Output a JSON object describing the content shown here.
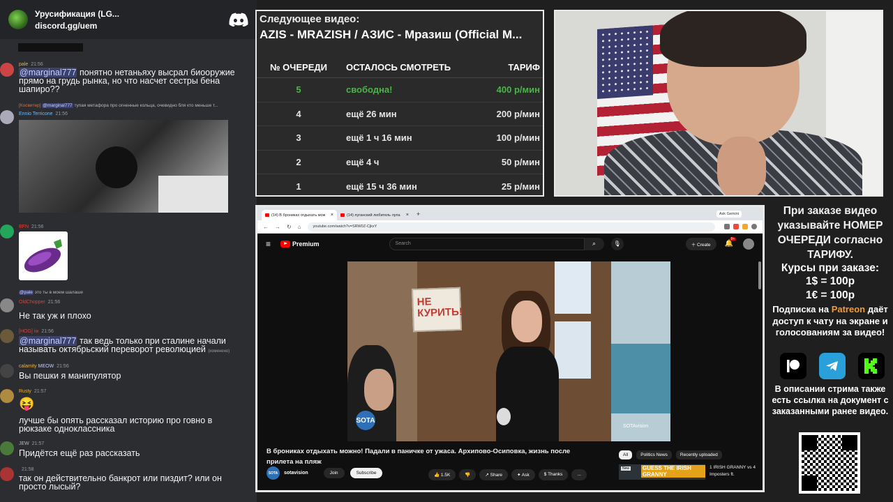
{
  "discord": {
    "server_name": "Урусификация (LG...",
    "server_link": "discord.gg/uem",
    "messages": [
      {
        "user": "pale",
        "time": "21:56",
        "user_color": "#f0b232",
        "mention": "@marginal777",
        "text": " понятно нетаньяху высрал биооружие прямо на грудь рынка, но что насчет сестры бена шапиро??"
      },
      {
        "reply": "тупая метафора про огненные кольца, очевидно бля кто меньше т...",
        "reply_user": "[Косвитер]",
        "reply_mention": "@marginal777",
        "user": "Ennio Terricone",
        "time": "21:56",
        "user_color": "#79b8f1"
      },
      {
        "user": "ВFN",
        "time": "21:56",
        "user_color": "#e0403a"
      },
      {
        "reply": "это ты в моем шалаше",
        "reply_mention": "@pale",
        "user": "OldChopper",
        "time": "21:56",
        "user_color": "#e0403a",
        "text": "Не так уж и плохо"
      },
      {
        "user": "[HOG] iw",
        "time": "21:56",
        "user_color": "#e0403a",
        "mention": "@marginal777",
        "text": " так ведь только при сталине начали называть октябрьский переворот революцией",
        "edited": "(изменено)"
      },
      {
        "user": "calamity",
        "badge": "MEOW",
        "time": "21:56",
        "user_color": "#f0b232",
        "text": "Вы пешки я манипулятор"
      },
      {
        "user": "Rusty",
        "time": "21:57",
        "user_color": "#f0b232",
        "text": "лучше бы опять рассказал историю про говно в рюкзаке одноклассника"
      },
      {
        "user": "JEW",
        "time": "21:57",
        "user_color": "#b5bac1",
        "text": "Придётся ещё раз рассказать"
      },
      {
        "user": "",
        "time": "21:58",
        "user_color": "#b5bac1",
        "text": "так он действительно банкрот или пиздит? или он просто лысый?"
      }
    ]
  },
  "queue": {
    "next_label": "Следующее видео:",
    "next_title": "AZIS - MRAZISH / АЗИС - Мразиш (Official M...",
    "headers": [
      "№ ОЧЕРЕДИ",
      "ОСТАЛОСЬ СМОТРЕТЬ",
      "ТАРИФ"
    ],
    "rows": [
      {
        "num": "5",
        "remaining": "свободна!",
        "rate": "400 р/мин"
      },
      {
        "num": "4",
        "remaining": "ещё 26 мин",
        "rate": "200 р/мин"
      },
      {
        "num": "3",
        "remaining": "ещё 1 ч 16 мин",
        "rate": "100 р/мин"
      },
      {
        "num": "2",
        "remaining": "ещё 4 ч",
        "rate": "50 р/мин"
      },
      {
        "num": "1",
        "remaining": "ещё 15 ч 36 мин",
        "rate": "25 р/мин"
      }
    ],
    "free_color": "#4db34a"
  },
  "browser": {
    "tabs": [
      "(14) В брониках отдыхать мож",
      "(14) луганский любитель лупа"
    ],
    "ask_gemini": "Ask Gemini",
    "url": "youtube.com/watch?v=SRW0Z-CjkxY",
    "yt_logo": "Premium",
    "search_placeholder": "Search",
    "create": "Create",
    "notif_badge": "9+",
    "video_title": "В брониках отдыхать можно! Падали в паничке от ужаса. Архипово-Осиповка, жизнь после прилета на пляж",
    "channel": "sotavision",
    "channel_logo": "SOTA",
    "join": "Join",
    "subscribe": "Subscribe",
    "likes": "1.5K",
    "share": "Share",
    "ask": "Ask",
    "thanks": "Thanks",
    "more": "...",
    "chips": [
      "All",
      "Politics News",
      "Recently uploaded"
    ],
    "rec_thumb_text": "GUESS THE IRISH GRANNY",
    "rec_new": "New",
    "rec_title": "1 IRISH GRANNY vs 4 Imposters ft.",
    "sign_text": "НЕ КУРИТЬ!",
    "watermark_left": "SOTA",
    "watermark_right": "SOTAvision"
  },
  "info": {
    "order": "При заказе видео указывайте НОМЕР ОЧЕРЕДИ согласно ТАРИФУ.",
    "rates_title": "Курсы при заказе:",
    "rate_usd": "1$ = 100р",
    "rate_eur": "1€ = 100р",
    "patreon_pre": "Подписка на ",
    "patreon_word": "Patreon",
    "patreon_post": " даёт доступ к чату на экране и голосованиям за видео!",
    "description": "В описании стрима также есть ссылка на документ с заказанными ранее видео."
  }
}
